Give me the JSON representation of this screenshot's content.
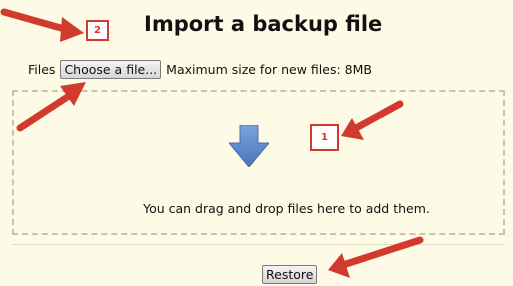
{
  "page": {
    "title": "Import a backup file"
  },
  "badges": {
    "step_title": "2",
    "step_dropzone": "1"
  },
  "upload": {
    "files_label": "Files",
    "choose_button_label": "Choose a file...",
    "max_size_text": "Maximum size for new files: 8MB"
  },
  "dropzone": {
    "instructions": "You can drag and drop files here to add them.",
    "arrow_icon": "down-arrow-icon"
  },
  "actions": {
    "restore_label": "Restore"
  },
  "colors": {
    "annotation_red": "#d23a2e",
    "arrow_blue": "#5b86c9",
    "background": "#fdfbe6"
  }
}
